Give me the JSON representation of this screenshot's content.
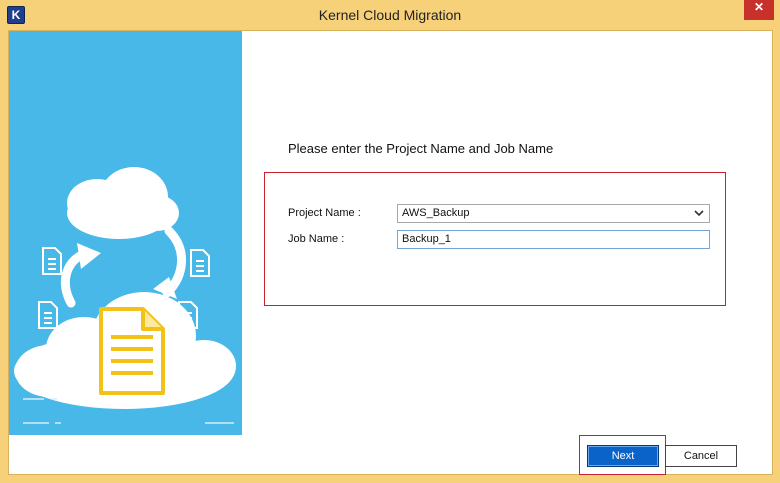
{
  "window": {
    "title": "Kernel Cloud Migration",
    "app_icon_letter": "K",
    "close_glyph": "✕"
  },
  "colors": {
    "title_bar": "#f6d17a",
    "side_panel": "#47b8e8",
    "highlight_border": "#c8202c",
    "next_button": "#0a63c8"
  },
  "form": {
    "instruction": "Please enter the Project Name and Job Name",
    "project_name_label": "Project Name :",
    "project_name_value": "AWS_Backup",
    "job_name_label": "Job Name :",
    "job_name_value": "Backup_1"
  },
  "buttons": {
    "next_label": "Next",
    "cancel_label": "Cancel"
  },
  "icons": [
    "cloud-icon",
    "document-icon",
    "arrow-icon",
    "chevron-down-icon"
  ]
}
